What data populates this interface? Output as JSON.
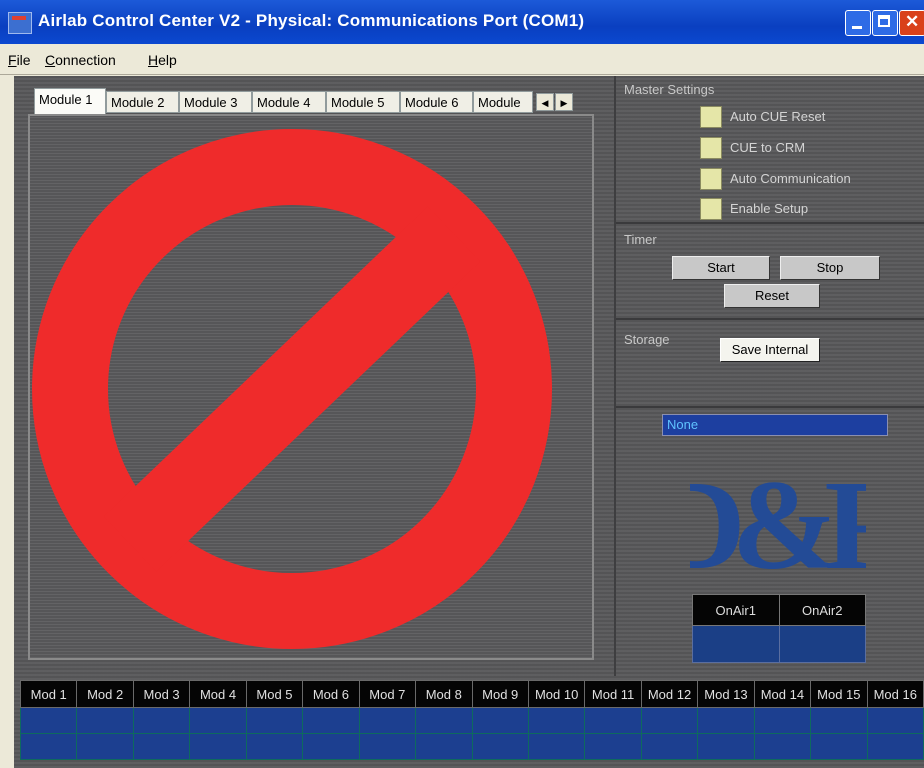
{
  "window": {
    "title": "Airlab Control Center V2 - Physical: Communications Port (COM1)"
  },
  "menu": [
    {
      "accel": "F",
      "rest": "ile"
    },
    {
      "accel": "C",
      "rest": "onnection"
    },
    {
      "accel": "H",
      "rest": "elp"
    }
  ],
  "tabs": [
    "Module 1",
    "Module 2",
    "Module 3",
    "Module 4",
    "Module 5",
    "Module 6",
    "Module"
  ],
  "active_tab": "Module 1",
  "master_settings": {
    "label": "Master Settings",
    "options": [
      "Auto CUE Reset",
      "CUE to CRM",
      "Auto Communication",
      "Enable Setup"
    ]
  },
  "timer": {
    "label": "Timer",
    "start": "Start",
    "stop": "Stop",
    "reset": "Reset"
  },
  "storage": {
    "label": "Storage",
    "save": "Save Internal"
  },
  "status_field": "None",
  "logo": {
    "text": "D&R"
  },
  "onair": {
    "headers": [
      "OnAir1",
      "OnAir2"
    ]
  },
  "mod_grid": {
    "headers": [
      "Mod 1",
      "Mod 2",
      "Mod 3",
      "Mod 4",
      "Mod 5",
      "Mod 6",
      "Mod 7",
      "Mod 8",
      "Mod 9",
      "Mod 10",
      "Mod 11",
      "Mod 12",
      "Mod 13",
      "Mod 14",
      "Mod 15",
      "Mod 16"
    ]
  },
  "colors": {
    "prohibition": "#ef2b2b",
    "grid_blue": "#1c3f90",
    "title_blue": "#0a3fc0"
  }
}
